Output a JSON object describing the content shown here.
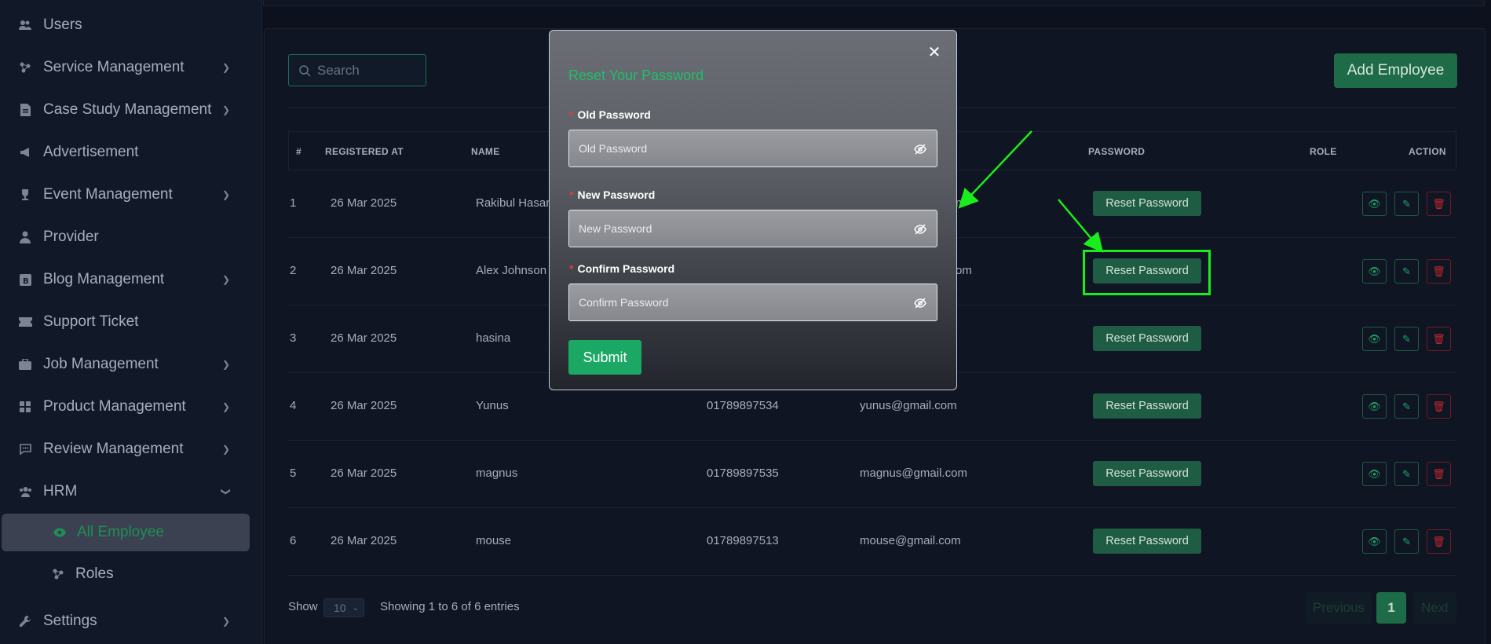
{
  "sidebar": {
    "items": [
      {
        "label": "Users",
        "icon": "users-icon",
        "chevron": false
      },
      {
        "label": "Service Management",
        "icon": "service-icon",
        "chevron": true
      },
      {
        "label": "Case Study Management",
        "icon": "document-icon",
        "chevron": true
      },
      {
        "label": "Advertisement",
        "icon": "megaphone-icon",
        "chevron": false
      },
      {
        "label": "Event Management",
        "icon": "trophy-icon",
        "chevron": true
      },
      {
        "label": "Provider",
        "icon": "user-icon",
        "chevron": false
      },
      {
        "label": "Blog Management",
        "icon": "blog-icon",
        "chevron": true
      },
      {
        "label": "Support Ticket",
        "icon": "ticket-icon",
        "chevron": false
      },
      {
        "label": "Job Management",
        "icon": "briefcase-icon",
        "chevron": true
      },
      {
        "label": "Product Management",
        "icon": "grid-icon",
        "chevron": true
      },
      {
        "label": "Review Management",
        "icon": "comment-icon",
        "chevron": true
      },
      {
        "label": "HRM",
        "icon": "team-icon",
        "chevron": true
      }
    ],
    "hrm_sub": [
      {
        "label": "All Employee",
        "icon": "eye-icon",
        "active": true
      },
      {
        "label": "Roles",
        "icon": "roles-icon",
        "active": false
      }
    ],
    "settings": {
      "label": "Settings",
      "icon": "wrench-icon"
    }
  },
  "toolbar": {
    "search_placeholder": "Search",
    "add_label": "Add Employee"
  },
  "table": {
    "headers": {
      "num": "#",
      "registered": "REGISTERED AT",
      "name": "NAME",
      "password": "PASSWORD",
      "role": "ROLE",
      "action": "ACTION"
    },
    "rows": [
      {
        "num": "1",
        "registered": "26 Mar 2025",
        "name": "Rakibul Hasan",
        "phone": "",
        "email": "m",
        "reset": "Reset Password"
      },
      {
        "num": "2",
        "registered": "26 Mar 2025",
        "name": "Alex Johnson",
        "phone": "",
        "email": "om",
        "reset": "Reset Password"
      },
      {
        "num": "3",
        "registered": "26 Mar 2025",
        "name": "hasina",
        "phone": "",
        "email": "",
        "reset": "Reset Password"
      },
      {
        "num": "4",
        "registered": "26 Mar 2025",
        "name": "Yunus",
        "phone": "01789897534",
        "email": "yunus@gmail.com",
        "reset": "Reset Password"
      },
      {
        "num": "5",
        "registered": "26 Mar 2025",
        "name": "magnus",
        "phone": "01789897535",
        "email": "magnus@gmail.com",
        "reset": "Reset Password"
      },
      {
        "num": "6",
        "registered": "26 Mar 2025",
        "name": "mouse",
        "phone": "01789897513",
        "email": "mouse@gmail.com",
        "reset": "Reset Password"
      }
    ]
  },
  "footer": {
    "show_label": "Show",
    "page_size": "10",
    "info": "Showing 1 to 6 of 6 entries",
    "prev": "Previous",
    "page": "1",
    "next": "Next"
  },
  "modal": {
    "title": "Reset Your Password",
    "old_label": "Old Password",
    "old_placeholder": "Old Password",
    "new_label": "New Password",
    "new_placeholder": "New Password",
    "confirm_label": "Confirm Password",
    "confirm_placeholder": "Confirm Password",
    "required_mark": "*",
    "submit": "Submit"
  },
  "colors": {
    "accent": "#1e6b48",
    "annotation": "#19ee1c",
    "danger": "#c0272d"
  }
}
